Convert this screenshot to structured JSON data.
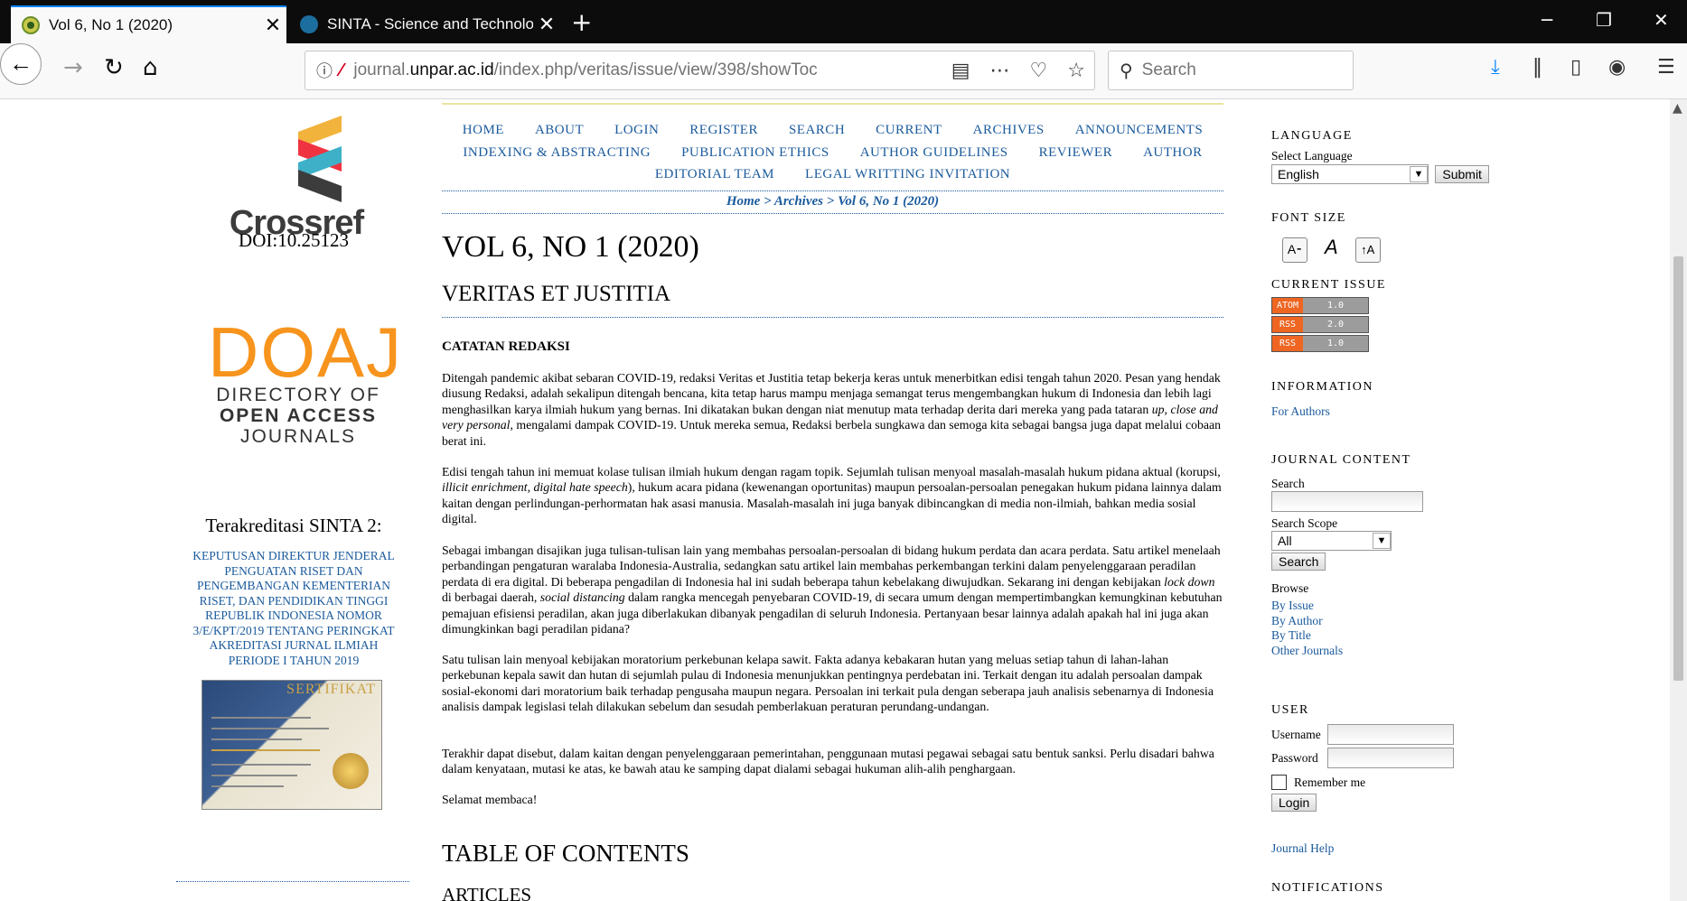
{
  "browser": {
    "tabs": [
      {
        "title": "Vol 6, No 1 (2020)",
        "close": "✕"
      },
      {
        "title": "SINTA - Science and Technolog",
        "close": "✕"
      }
    ],
    "new_tab": "+",
    "window_controls": {
      "minimize": "─",
      "restore": "❐",
      "close": "✕"
    },
    "url": {
      "prefix": "journal.",
      "domain": "unpar.ac.id",
      "path": "/index.php/veritas/issue/view/398/showToc"
    },
    "search_placeholder": "Search"
  },
  "left": {
    "crossref_word": "Crossref",
    "doi": "DOI:10.25123",
    "doaj": {
      "word": "DOAJ",
      "line1": "DIRECTORY OF",
      "line2": "OPEN ACCESS",
      "line3": "JOURNALS"
    },
    "sinta_title": "Terakreditasi SINTA 2:",
    "sinta_link": "KEPUTUSAN DIREKTUR JENDERAL PENGUATAN RISET DAN PENGEMBANGAN KEMENTERIAN RISET, DAN PENDIDIKAN TINGGI REPUBLIK INDONESIA NOMOR 3/E/KPT/2019 TENTANG PERINGKAT AKREDITASI JURNAL ILMIAH PERIODE I TAHUN 2019",
    "certificate_title": "SERTIFIKAT"
  },
  "menu": {
    "row1": [
      "HOME",
      "ABOUT",
      "LOGIN",
      "REGISTER",
      "SEARCH",
      "CURRENT",
      "ARCHIVES",
      "ANNOUNCEMENTS"
    ],
    "row2": [
      "INDEXING & ABSTRACTING",
      "PUBLICATION ETHICS",
      "AUTHOR GUIDELINES",
      "REVIEWER",
      "AUTHOR"
    ],
    "row3": [
      "EDITORIAL TEAM",
      "LEGAL WRITTING INVITATION"
    ]
  },
  "breadcrumb": {
    "home": "Home",
    "sep": ">",
    "archives": "Archives",
    "current": "Vol 6, No 1 (2020)"
  },
  "main": {
    "volume_title": "VOL 6, NO 1 (2020)",
    "journal_title": "VERITAS ET JUSTITIA",
    "section_heading": "CATATAN REDAKSI",
    "p1": {
      "a": "Ditengah pandemic akibat sebaran COVID-19, redaksi Veritas et Justitia tetap bekerja keras untuk menerbitkan edisi tengah tahun 2020. Pesan yang hendak diusung Redaksi, adalah sekalipun ditengah bencana, kita tetap harus mampu menjaga semangat terus mengembangkan hukum di Indonesia dan lebih lagi menghasilkan karya ilmiah hukum yang bernas.  Ini dikatakan bukan dengan niat menutup mata terhadap derita dari mereka yang pada tataran ",
      "em": "up, close and very personal",
      "b": ", mengalami dampak COVID-19.   Untuk mereka semua, Redaksi berbela sungkawa dan semoga kita sebagai bangsa juga dapat melalui cobaan berat ini."
    },
    "p2": {
      "a": "Edisi tengah tahun ini memuat kolase tulisan ilmiah hukum dengan ragam topik.  Sejumlah tulisan menyoal masalah-masalah hukum pidana aktual (korupsi, ",
      "em": "illicit enrichment, digital hate speech",
      "b": "), hukum acara pidana (kewenangan oportunitas) maupun persoalan-persoalan penegakan hukum pidana lainnya dalam kaitan dengan perlindungan-perhormatan hak asasi manusia.   Masalah-masalah ini juga banyak dibincangkan di media non-ilmiah, bahkan media sosial digital."
    },
    "p3": {
      "a": "Sebagai imbangan disajikan juga tulisan-tulisan lain yang membahas persoalan-persoalan di bidang hukum perdata dan acara perdata.  Satu artikel menelaah perbandingan pengaturan waralaba Indonesia-Australia, sedangkan satu artikel lain membahas perkembangan terkini dalam penyelenggaraan peradilan perdata di era digital. Di beberapa pengadilan di Indonesia hal ini sudah beberapa tahun kebelakang diwujudkan.  Sekarang ini dengan kebijakan ",
      "em1": "lock down",
      "b": " di berbagai daerah, ",
      "em2": "social distancing",
      "c": " dalam rangka mencegah penyebaran COVID-19, di secara umum dengan mempertimbangkan kemungkinan kebutuhan pemajuan efisiensi peradilan, akan juga diberlakukan dibanyak pengadilan di seluruh Indonesia.  Pertanyaan besar lainnya adalah apakah hal ini juga akan dimungkinkan bagi peradilan pidana?"
    },
    "p4": "Satu tulisan lain menyoal kebijakan moratorium perkebunan kelapa sawit.  Fakta adanya kebakaran hutan yang meluas setiap tahun di lahan-lahan perkebunan kepala sawit dan hutan di sejumlah pulau di Indonesia menunjukkan pentingnya perdebatan ini.  Terkait dengan itu adalah persoalan dampak sosial-ekonomi dari moratorium baik terhadap pengusaha maupun negara.  Persoalan ini terkait pula dengan seberapa jauh analisis sebenarnya di Indonesia analisis dampak legislasi telah dilakukan sebelum dan sesudah pemberlakuan peraturan perundang-undangan.",
    "p5": "Terakhir dapat disebut, dalam kaitan dengan penyelenggaraan pemerintahan, penggunaan mutasi pegawai sebagai satu bentuk sanksi. Perlu disadari bahwa dalam kenyataan, mutasi ke atas, ke bawah atau ke samping dapat dialami sebagai hukuman alih-alih penghargaan.",
    "p6": "Selamat membaca!",
    "toc": "TABLE OF CONTENTS",
    "articles": "ARTICLES"
  },
  "right": {
    "language": {
      "heading": "LANGUAGE",
      "label": "Select Language",
      "value": "English",
      "submit": "Submit"
    },
    "font_size": {
      "heading": "FONT SIZE"
    },
    "current_issue": {
      "heading": "CURRENT ISSUE",
      "feeds": [
        {
          "k": "ATOM",
          "v": "1.0"
        },
        {
          "k": "RSS",
          "v": "2.0"
        },
        {
          "k": "RSS",
          "v": "1.0"
        }
      ]
    },
    "information": {
      "heading": "INFORMATION",
      "link": "For Authors"
    },
    "journal_content": {
      "heading": "JOURNAL CONTENT",
      "search_label": "Search",
      "scope_label": "Search Scope",
      "scope_value": "All",
      "search_button": "Search",
      "browse_label": "Browse",
      "browse_links": [
        "By Issue",
        "By Author",
        "By Title",
        "Other Journals"
      ]
    },
    "user": {
      "heading": "USER",
      "username": "Username",
      "password": "Password",
      "remember": "Remember me",
      "login": "Login"
    },
    "help": "Journal Help",
    "notifications": "NOTIFICATIONS"
  }
}
